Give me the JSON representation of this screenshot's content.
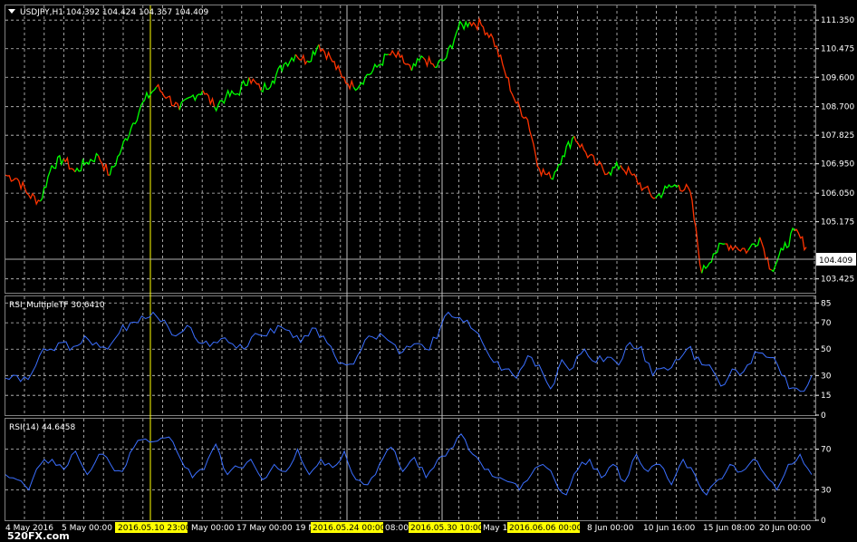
{
  "main": {
    "header": "USDJPY,H1  104.392 104.424 104.357 104.409",
    "price_labels": [
      "111.350",
      "110.475",
      "109.600",
      "108.700",
      "107.825",
      "106.950",
      "106.050",
      "105.175",
      "103.425"
    ],
    "current_price": "104.409"
  },
  "rsi_mtf": {
    "header": "RSI_MultipleTF 30.6410",
    "levels": [
      "85",
      "70",
      "50",
      "30",
      "15",
      "0"
    ]
  },
  "rsi14": {
    "header": "RSI(14) 44.6458",
    "levels": [
      "70",
      "30",
      "0"
    ]
  },
  "time_axis": {
    "labels": [
      "4 May 2016",
      "5 May 00:00",
      "May 00:00",
      "17 May 00:00",
      "19 M",
      "08:00",
      "May 1",
      "8 Jun 00:00",
      "10 Jun 16:00",
      "15 Jun 08:00",
      "20 Jun 00:00"
    ],
    "highlights": [
      "2016.05.10 23:00",
      "2016.05.24 00:00",
      "2016.05.30 10:00",
      "2016.06.06 00:00"
    ]
  },
  "watermark": "520FX.com",
  "colors": {
    "background": "#000000",
    "bull": "#00ff00",
    "bear": "#ff3300",
    "rsi_line": "#3b6fff",
    "crosshair": "#ffff00",
    "highlight_bg": "#ffff00"
  },
  "chart_data": [
    {
      "type": "line",
      "title": "USDJPY,H1",
      "series": [
        {
          "name": "USDJPY",
          "values": [
            106.6,
            106.5,
            106.0,
            105.8,
            106.9,
            107.1,
            106.7,
            107.0,
            107.2,
            106.6,
            107.4,
            108.2,
            108.9,
            109.3,
            109.0,
            108.6,
            109.0,
            109.2,
            108.7,
            109.0,
            109.1,
            109.6,
            109.2,
            109.5,
            110.0,
            110.3,
            110.1,
            110.6,
            110.2,
            109.6,
            109.3,
            109.6,
            109.9,
            110.3,
            110.2,
            109.8,
            110.2,
            109.9,
            110.2,
            111.1,
            111.3,
            111.2,
            110.8,
            109.8,
            108.8,
            108.3,
            106.8,
            106.5,
            107.2,
            107.8,
            107.3,
            106.9,
            106.7,
            106.9,
            106.6,
            106.2,
            105.9,
            106.2,
            106.3,
            106.1,
            103.6,
            104.2,
            104.5,
            104.4,
            104.3,
            104.7,
            103.7,
            104.3,
            104.9,
            104.4
          ]
        }
      ],
      "ylim": [
        103.0,
        111.8
      ]
    },
    {
      "type": "line",
      "title": "RSI_MultipleTF",
      "series": [
        {
          "name": "RSI_MultipleTF",
          "values": [
            28,
            30,
            27,
            45,
            50,
            55,
            52,
            60,
            55,
            50,
            62,
            70,
            75,
            78,
            72,
            60,
            68,
            55,
            52,
            58,
            54,
            50,
            62,
            60,
            68,
            64,
            55,
            66,
            60,
            45,
            38,
            45,
            60,
            62,
            55,
            48,
            54,
            50,
            58,
            78,
            74,
            66,
            55,
            40,
            35,
            28,
            45,
            38,
            20,
            42,
            36,
            50,
            40,
            44,
            38,
            55,
            52,
            30,
            36,
            42,
            50,
            44,
            38,
            22,
            35,
            33,
            48,
            44,
            38,
            20,
            18,
            30
          ]
        }
      ],
      "ylim": [
        0,
        90
      ]
    },
    {
      "type": "line",
      "title": "RSI(14)",
      "series": [
        {
          "name": "RSI(14)",
          "values": [
            45,
            40,
            30,
            55,
            60,
            50,
            68,
            45,
            65,
            55,
            48,
            72,
            80,
            78,
            82,
            60,
            42,
            50,
            75,
            45,
            52,
            60,
            40,
            55,
            48,
            70,
            45,
            60,
            52,
            68,
            40,
            35,
            55,
            72,
            48,
            62,
            42,
            60,
            70,
            85,
            65,
            50,
            42,
            38,
            30,
            45,
            55,
            40,
            25,
            50,
            60,
            42,
            55,
            38,
            65,
            48,
            55,
            35,
            60,
            45,
            25,
            40,
            55,
            48,
            60,
            45,
            30,
            55,
            65,
            45
          ]
        }
      ],
      "ylim": [
        0,
        100
      ]
    }
  ]
}
